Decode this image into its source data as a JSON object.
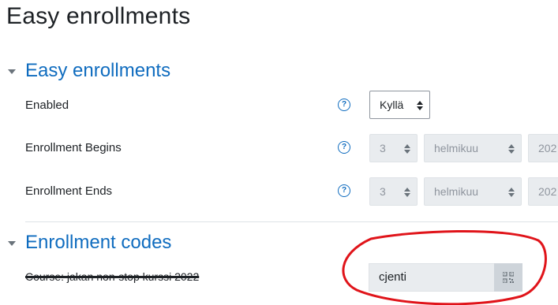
{
  "page": {
    "title": "Easy enrollments"
  },
  "sections": {
    "easy": {
      "title": "Easy enrollments"
    },
    "codes": {
      "title": "Enrollment codes"
    }
  },
  "fields": {
    "enabled": {
      "label": "Enabled",
      "value": "Kyllä"
    },
    "begins": {
      "label": "Enrollment Begins",
      "day": "3",
      "month": "helmikuu",
      "year": "202"
    },
    "ends": {
      "label": "Enrollment Ends",
      "day": "3",
      "month": "helmikuu",
      "year": "202"
    }
  },
  "codes": {
    "course_label": "Course: jakan non-stop kurssi 2022",
    "code_value": "cjenti"
  },
  "icons": {
    "help": "?",
    "qr": "qr-code-icon"
  },
  "colors": {
    "accent": "#0f6cbf",
    "annotation": "#e0141a"
  }
}
